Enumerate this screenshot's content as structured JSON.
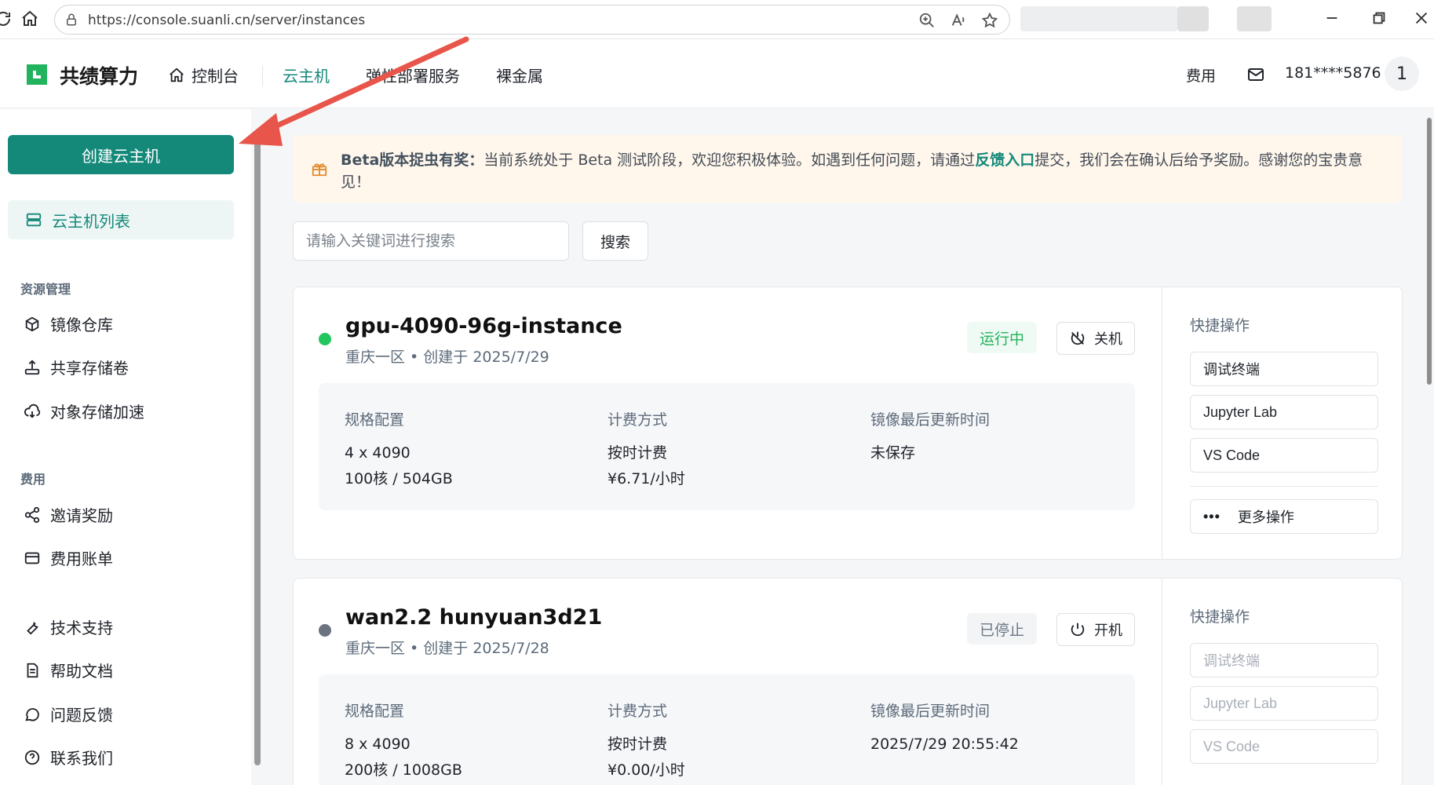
{
  "browser": {
    "url": "https://console.suanli.cn/server/instances"
  },
  "header": {
    "brand": "共绩算力",
    "nav": [
      {
        "label": "控制台"
      },
      {
        "label": "云主机"
      },
      {
        "label": "弹性部署服务"
      },
      {
        "label": "裸金属"
      }
    ],
    "fees_label": "费用",
    "phone": "181****5876",
    "avatar_text": "1",
    "accent_color": "#14897a"
  },
  "sidebar": {
    "create_button": "创建云主机",
    "active_item": "云主机列表",
    "section_resources": "资源管理",
    "resources": [
      "镜像仓库",
      "共享存储卷",
      "对象存储加速"
    ],
    "section_fees": "费用",
    "fees": [
      "邀请奖励",
      "费用账单"
    ],
    "support": [
      "技术支持",
      "帮助文档",
      "问题反馈",
      "联系我们"
    ]
  },
  "banner": {
    "title": "Beta版本捉虫有奖：",
    "text_before_link": "当前系统处于 Beta 测试阶段，欢迎您积极体验。如遇到任何问题，请通过",
    "link": "反馈入口",
    "text_after_link": "提交，我们会在确认后给予奖励。感谢您的宝贵意见！"
  },
  "search": {
    "placeholder": "请输入关键词进行搜索",
    "button": "搜索"
  },
  "instances": [
    {
      "name": "gpu-4090-96g-instance",
      "meta": "重庆一区 • 创建于 2025/7/29",
      "status": "运行中",
      "status_color": "#22b35e",
      "power_button": "关机",
      "spec_label": "规格配置",
      "spec_gpu": "4 x 4090",
      "spec_cpu": "100核 / 504GB",
      "billing_label": "计费方式",
      "billing_mode": "按时计费",
      "billing_price": "¥6.71/小时",
      "image_label": "镜像最后更新时间",
      "image_time": "未保存",
      "quick_title": "快捷操作",
      "quick_actions": [
        "调试终端",
        "Jupyter Lab",
        "VS Code"
      ],
      "more_actions": "更多操作"
    },
    {
      "name": "wan2.2 hunyuan3d21",
      "meta": "重庆一区 • 创建于 2025/7/28",
      "status": "已停止",
      "status_color": "#6b7785",
      "power_button": "开机",
      "spec_label": "规格配置",
      "spec_gpu": "8 x 4090",
      "spec_cpu": "200核 / 1008GB",
      "billing_label": "计费方式",
      "billing_mode": "按时计费",
      "billing_price": "¥0.00/小时",
      "image_label": "镜像最后更新时间",
      "image_time": "2025/7/29 20:55:42",
      "quick_title": "快捷操作",
      "quick_actions": [
        "调试终端",
        "Jupyter Lab",
        "VS Code"
      ]
    }
  ]
}
